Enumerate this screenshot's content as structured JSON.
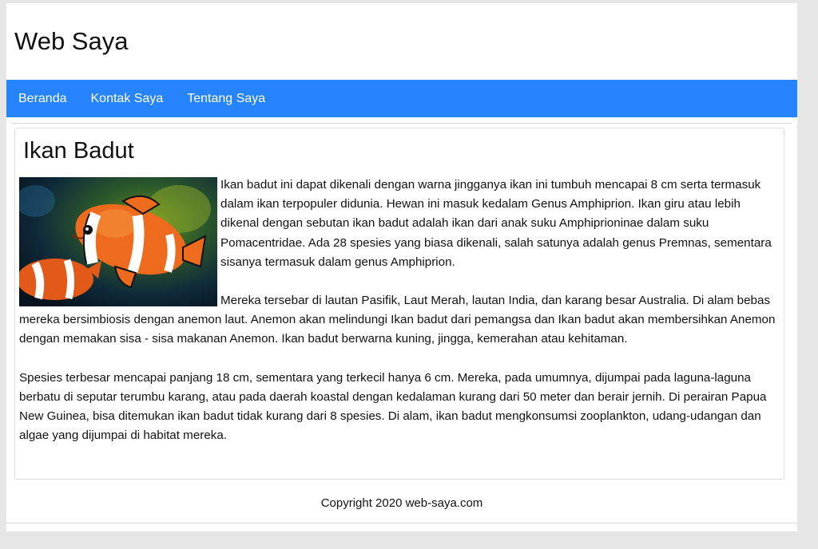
{
  "site": {
    "title": "Web Saya"
  },
  "nav": {
    "items": [
      {
        "label": "Beranda"
      },
      {
        "label": "Kontak Saya"
      },
      {
        "label": "Tentang Saya"
      }
    ]
  },
  "article": {
    "title": "Ikan Badut",
    "image": "clownfish-photo",
    "paragraphs": [
      "Ikan badut ini dapat dikenali dengan warna jingganya ikan ini tumbuh mencapai 8 cm serta termasuk dalam ikan terpopuler didunia. Hewan ini masuk kedalam Genus Amphiprion. Ikan giru atau lebih dikenal dengan sebutan ikan badut adalah ikan dari anak suku Amphiprioninae dalam suku Pomacentridae. Ada 28 spesies yang biasa dikenali, salah satunya adalah genus Premnas, sementara sisanya termasuk dalam genus Amphiprion.",
      "Mereka tersebar di lautan Pasifik, Laut Merah, lautan India, dan karang besar Australia. Di alam bebas mereka bersimbiosis dengan anemon laut. Anemon akan melindungi Ikan badut dari pemangsa dan Ikan badut akan membersihkan Anemon dengan memakan sisa - sisa makanan Anemon. Ikan badut berwarna kuning, jingga, kemerahan atau kehitaman.",
      "Spesies terbesar mencapai panjang 18 cm, sementara yang terkecil hanya 6 cm. Mereka, pada umumnya, dijumpai pada laguna-laguna berbatu di seputar terumbu karang, atau pada daerah koastal dengan kedalaman kurang dari 50 meter dan berair jernih. Di perairan Papua New Guinea, bisa ditemukan ikan badut tidak kurang dari 8 spesies. Di alam, ikan badut mengkonsumsi zooplankton, udang-udangan dan algae yang dijumpai di habitat mereka."
    ]
  },
  "footer": {
    "copyright": "Copyright 2020 web-saya.com"
  },
  "colors": {
    "nav_bg": "#2684ff",
    "page_bg": "#e6e6e6"
  }
}
